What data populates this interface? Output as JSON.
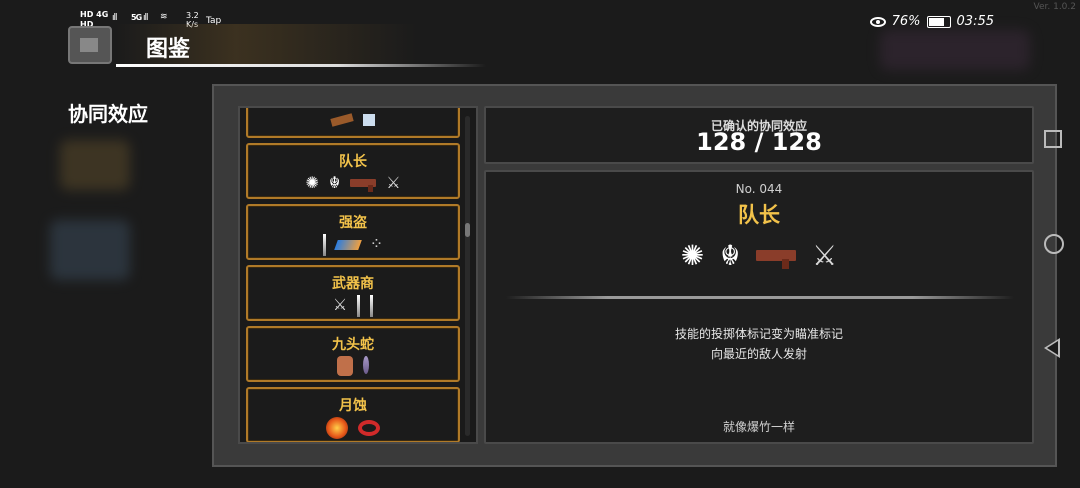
{
  "status_bar": {
    "network_top": "HD 4G",
    "network_bottom": "HD",
    "signal_1": "ıll",
    "signal_2_label": "5G",
    "signal_2": "ıll",
    "speed": "3.2\nK/s",
    "tap": "Tap",
    "battery_percent": "76%",
    "battery_level": 0.76,
    "time": "03:55",
    "version": "Ver. 1.0.2"
  },
  "header": {
    "title": "图鉴"
  },
  "section_title": "协同效应",
  "count": {
    "label": "已确认的协同效应",
    "value": "128 / 128"
  },
  "synergy_list": [
    {
      "name": "",
      "icons": [
        "plank",
        "scroll"
      ]
    },
    {
      "name": "队长",
      "icons": [
        "burst",
        "spider",
        "gun",
        "swords"
      ]
    },
    {
      "name": "强盗",
      "icons": [
        "knife",
        "book",
        "dot"
      ]
    },
    {
      "name": "武器商",
      "icons": [
        "swords",
        "knife",
        "knife"
      ]
    },
    {
      "name": "九头蛇",
      "icons": [
        "jar",
        "leaf"
      ]
    },
    {
      "name": "月蚀",
      "icons": [
        "fire",
        "ring"
      ]
    }
  ],
  "scroll_position": 0.35,
  "detail": {
    "number": "No. 044",
    "name": "队长",
    "icons": [
      "burst",
      "spider",
      "gun",
      "swords"
    ],
    "description_line1": "技能的投掷体标记变为瞄准标记",
    "description_line2": "向最近的敌人发射",
    "quote": "就像爆竹一样"
  },
  "icon_glyphs": {
    "burst": "✺",
    "spider": "☬",
    "swords": "⚔",
    "dot": "⁘"
  },
  "colors": {
    "accent_gold": "#f2c24a",
    "item_border": "#b07a28",
    "panel_bg": "#3a3a3a",
    "box_bg": "#1e1e1e"
  }
}
